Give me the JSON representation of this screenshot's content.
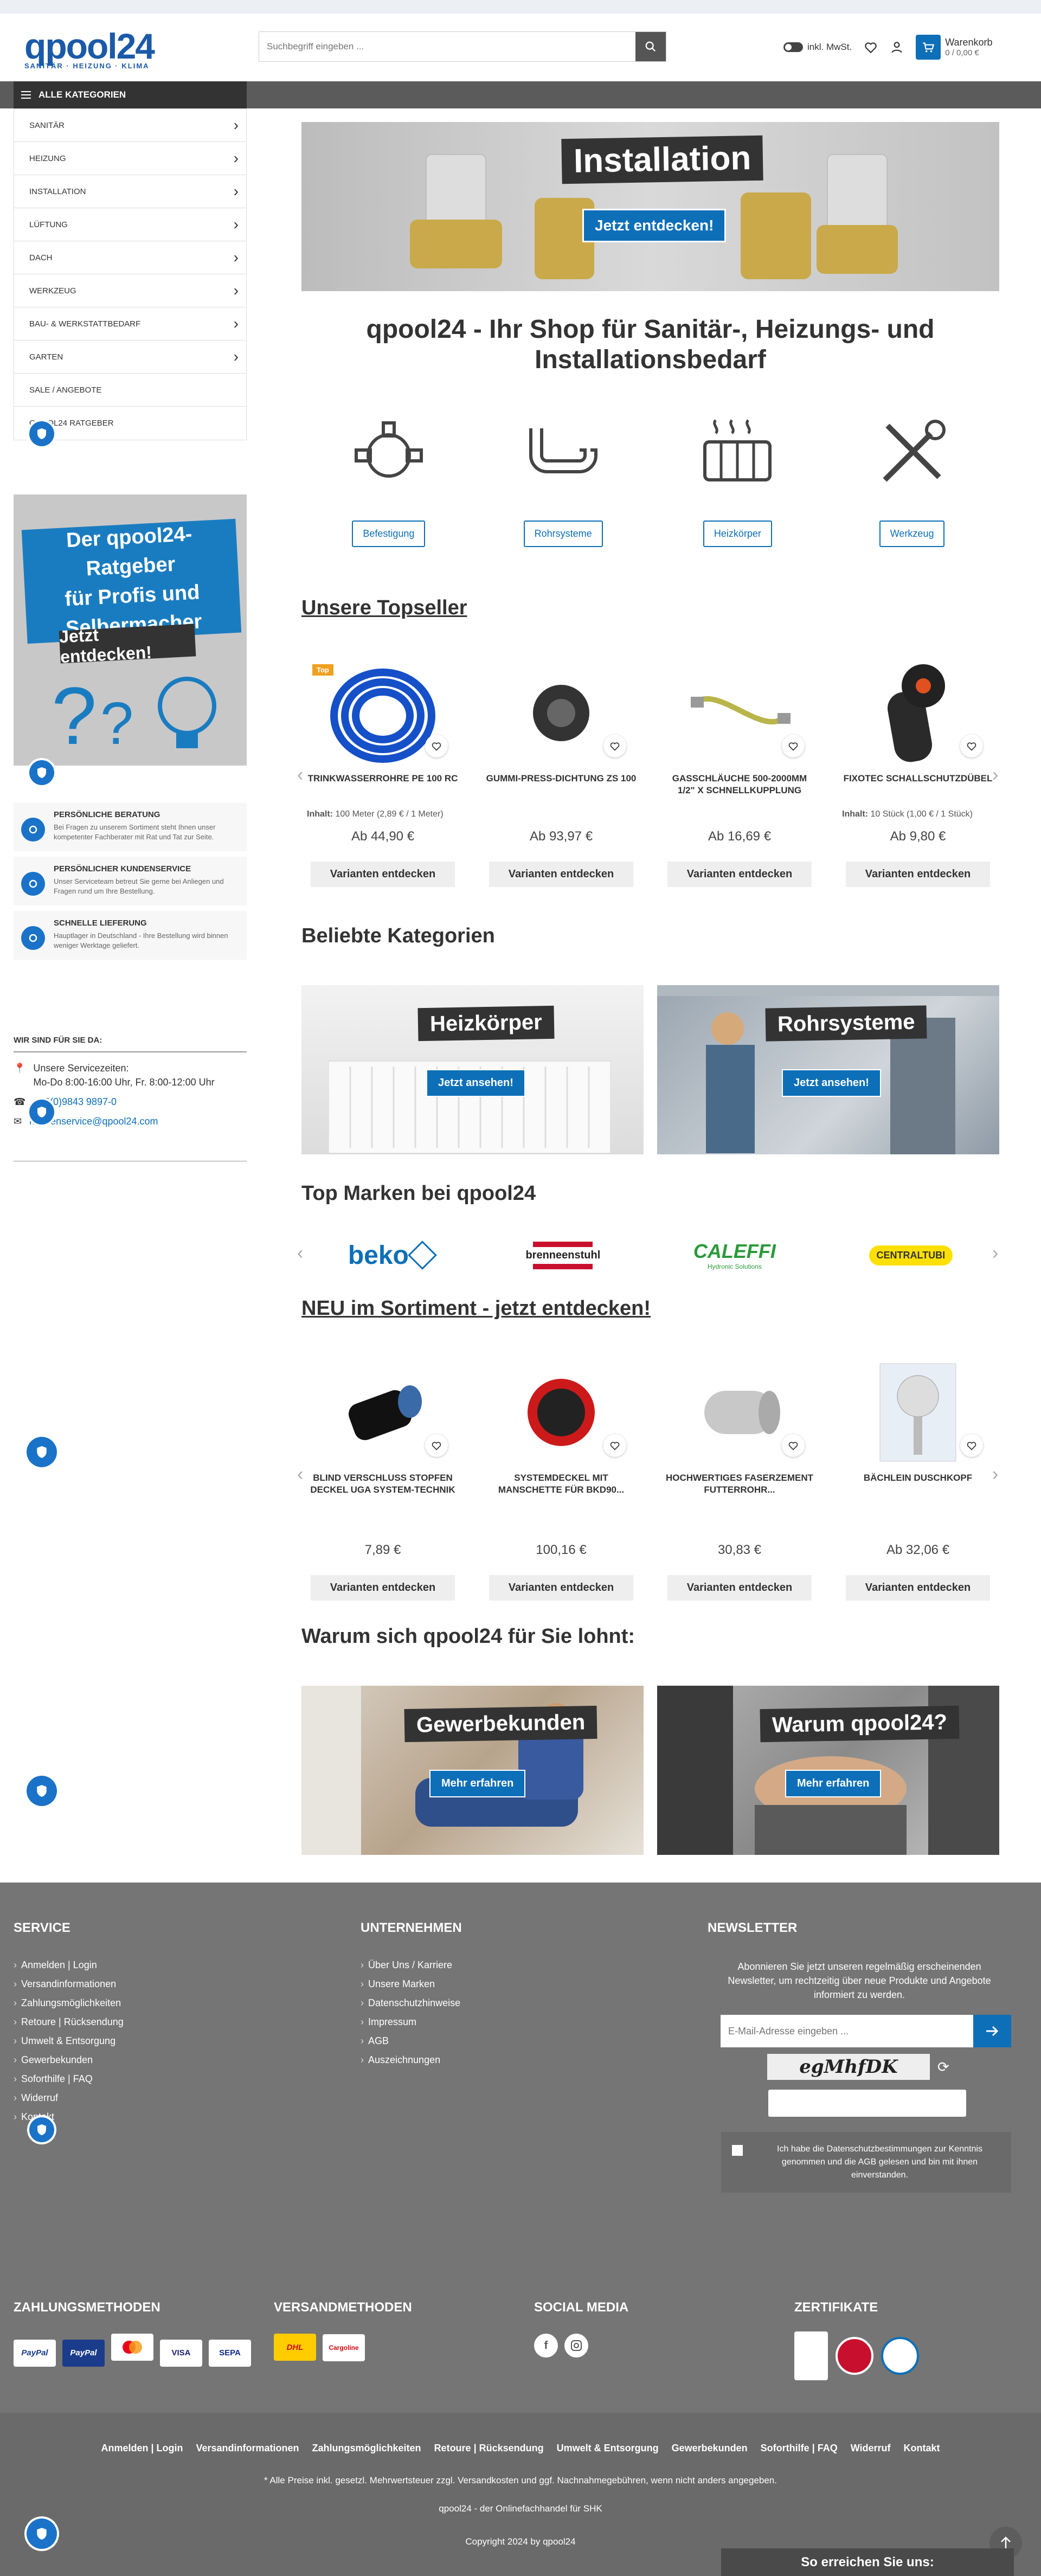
{
  "header": {
    "logo_text": "qpool24",
    "logo_sub": "SANITÄR · HEIZUNG · KLIMA",
    "search_placeholder": "Suchbegriff eingeben ...",
    "vat_label": "inkl. MwSt.",
    "cart_label": "Warenkorb",
    "cart_value": "0 / 0,00 €"
  },
  "nav": {
    "all_categories": "ALLE KATEGORIEN"
  },
  "categories": [
    "SANITÄR",
    "HEIZUNG",
    "INSTALLATION",
    "LÜFTUNG",
    "DACH",
    "WERKZEUG",
    "BAU- & WERKSTATTBEDARF",
    "GARTEN",
    "SALE / ANGEBOTE",
    "QPOOL24 RATGEBER"
  ],
  "ratgeber": {
    "line1": "Der qpool24-Ratgeber",
    "line2": "für Profis und",
    "line3": "Selbermacher",
    "cta": "Jetzt entdecken!"
  },
  "services": [
    {
      "title": "PERSÖNLICHE BERATUNG",
      "text": "Bei Fragen zu unserem Sortiment steht Ihnen unser kompetenter Fachberater mit Rat und Tat zur Seite."
    },
    {
      "title": "PERSÖNLICHER KUNDENSERVICE",
      "text": "Unser Serviceteam betreut Sie gerne bei Anliegen und Fragen rund um Ihre Bestellung."
    },
    {
      "title": "SCHNELLE LIEFERUNG",
      "text": "Hauptlager in Deutschland - Ihre Bestellung wird binnen weniger Werktage geliefert."
    }
  ],
  "contact": {
    "title": "WIR SIND FÜR SIE DA:",
    "hours_label": "Unsere Servicezeiten:",
    "hours": "Mo-Do 8:00-16:00 Uhr, Fr. 8:00-12:00 Uhr",
    "phone": "+49(0)9843 9897-0",
    "email": "kundenservice@qpool24.com"
  },
  "hero": {
    "title": "Installation",
    "cta": "Jetzt entdecken!"
  },
  "main_title": "qpool24 - Ihr Shop für Sanitär-, Heizungs- und Installationsbedarf",
  "quick_categories": [
    "Befestigung",
    "Rohrsysteme",
    "Heizkörper",
    "Werkzeug"
  ],
  "topseller": {
    "title": "Unsere Topseller",
    "badge": "Top",
    "items": [
      {
        "name": "TRINKWASSERROHRE PE 100 RC",
        "info_label": "Inhalt:",
        "info": "100 Meter (2,89 € / 1 Meter)",
        "price": "Ab 44,90 €",
        "button": "Varianten entdecken"
      },
      {
        "name": "GUMMI-PRESS-DICHTUNG ZS 100",
        "info_label": "",
        "info": "",
        "price": "Ab 93,97 €",
        "button": "Varianten entdecken"
      },
      {
        "name": "GASSCHLÄUCHE 500-2000MM 1/2\" X SCHNELLKUPPLUNG",
        "info_label": "",
        "info": "",
        "price": "Ab 16,69 €",
        "button": "Varianten entdecken"
      },
      {
        "name": "FIXOTEC SCHALLSCHUTZDÜBEL",
        "info_label": "Inhalt:",
        "info": "10 Stück (1,00 € / 1 Stück)",
        "price": "Ab 9,80 €",
        "button": "Varianten entdecken"
      }
    ]
  },
  "popular": {
    "title": "Beliebte Kategorien",
    "items": [
      {
        "title": "Heizkörper",
        "cta": "Jetzt ansehen!"
      },
      {
        "title": "Rohrsysteme",
        "cta": "Jetzt ansehen!"
      }
    ]
  },
  "brands": {
    "title": "Top Marken bei qpool24",
    "items": [
      "beko",
      "brenneenstuhl",
      "CALEFFI",
      "CENTRALTUBI"
    ],
    "caleffi_sub": "Hydronic Solutions"
  },
  "new": {
    "title": "NEU im Sortiment - jetzt entdecken!",
    "items": [
      {
        "name": "BLIND VERSCHLUSS STOPFEN DECKEL UGA SYSTEM-TECHNIK",
        "price": "7,89 €",
        "button": "Varianten entdecken"
      },
      {
        "name": "SYSTEMDECKEL MIT MANSCHETTE FÜR BKD90...",
        "price": "100,16 €",
        "button": "Varianten entdecken"
      },
      {
        "name": "HOCHWERTIGES FASERZEMENT FUTTERROHR...",
        "price": "30,83 €",
        "button": "Varianten entdecken"
      },
      {
        "name": "BÄCHLEIN DUSCHKOPF",
        "price": "Ab 32,06 €",
        "button": "Varianten entdecken"
      }
    ]
  },
  "why": {
    "title": "Warum sich qpool24 für Sie lohnt:",
    "items": [
      {
        "title": "Gewerbekunden",
        "cta": "Mehr erfahren"
      },
      {
        "title": "Warum qpool24?",
        "cta": "Mehr erfahren"
      }
    ]
  },
  "footer": {
    "service_title": "SERVICE",
    "service_links": [
      "Anmelden | Login",
      "Versandinformationen",
      "Zahlungsmöglichkeiten",
      "Retoure | Rücksendung",
      "Umwelt & Entsorgung",
      "Gewerbekunden",
      "Soforthilfe | FAQ",
      "Widerruf",
      "Kontakt"
    ],
    "company_title": "UNTERNEHMEN",
    "company_links": [
      "Über Uns / Karriere",
      "Unsere Marken",
      "Datenschutzhinweise",
      "Impressum",
      "AGB",
      "Auszeichnungen"
    ],
    "newsletter_title": "NEWSLETTER",
    "newsletter_text": "Abonnieren Sie jetzt unseren regelmäßig erscheinenden Newsletter, um rechtzeitig über neue Produkte und Angebote informiert zu werden.",
    "email_placeholder": "E-Mail-Adresse eingeben ...",
    "captcha": "egMhfDK",
    "privacy_text": "Ich habe die Datenschutzbestimmungen zur Kenntnis genommen und die AGB gelesen und bin mit ihnen einverstanden.",
    "payment_title": "ZAHLUNGSMETHODEN",
    "payments": [
      "PayPal",
      "PayPal",
      "VISA",
      "SEPA"
    ],
    "shipping_title": "VERSANDMETHODEN",
    "shipping": [
      "DHL",
      "Cargoline"
    ],
    "social_title": "SOCIAL MEDIA",
    "cert_title": "ZERTIFIKATE",
    "bottom_links": [
      "Anmelden | Login",
      "Versandinformationen",
      "Zahlungsmöglichkeiten",
      "Retoure | Rücksendung",
      "Umwelt & Entsorgung",
      "Gewerbekunden",
      "Soforthilfe | FAQ",
      "Widerruf",
      "Kontakt"
    ],
    "price_note": "* Alle Preise inkl. gesetzl. Mehrwertsteuer zzgl. Versandkosten und ggf. Nachnahmegebühren, wenn nicht anders angegeben.",
    "tagline": "qpool24 - der Onlinefachhandel für SHK",
    "copyright": "Copyright 2024 by qpool24",
    "reach": "So erreichen Sie uns:"
  },
  "colors": {
    "brand": "#1b5aa8",
    "accent": "#0d6fb8",
    "footer": "#757575",
    "nav": "#5b5b5b"
  }
}
